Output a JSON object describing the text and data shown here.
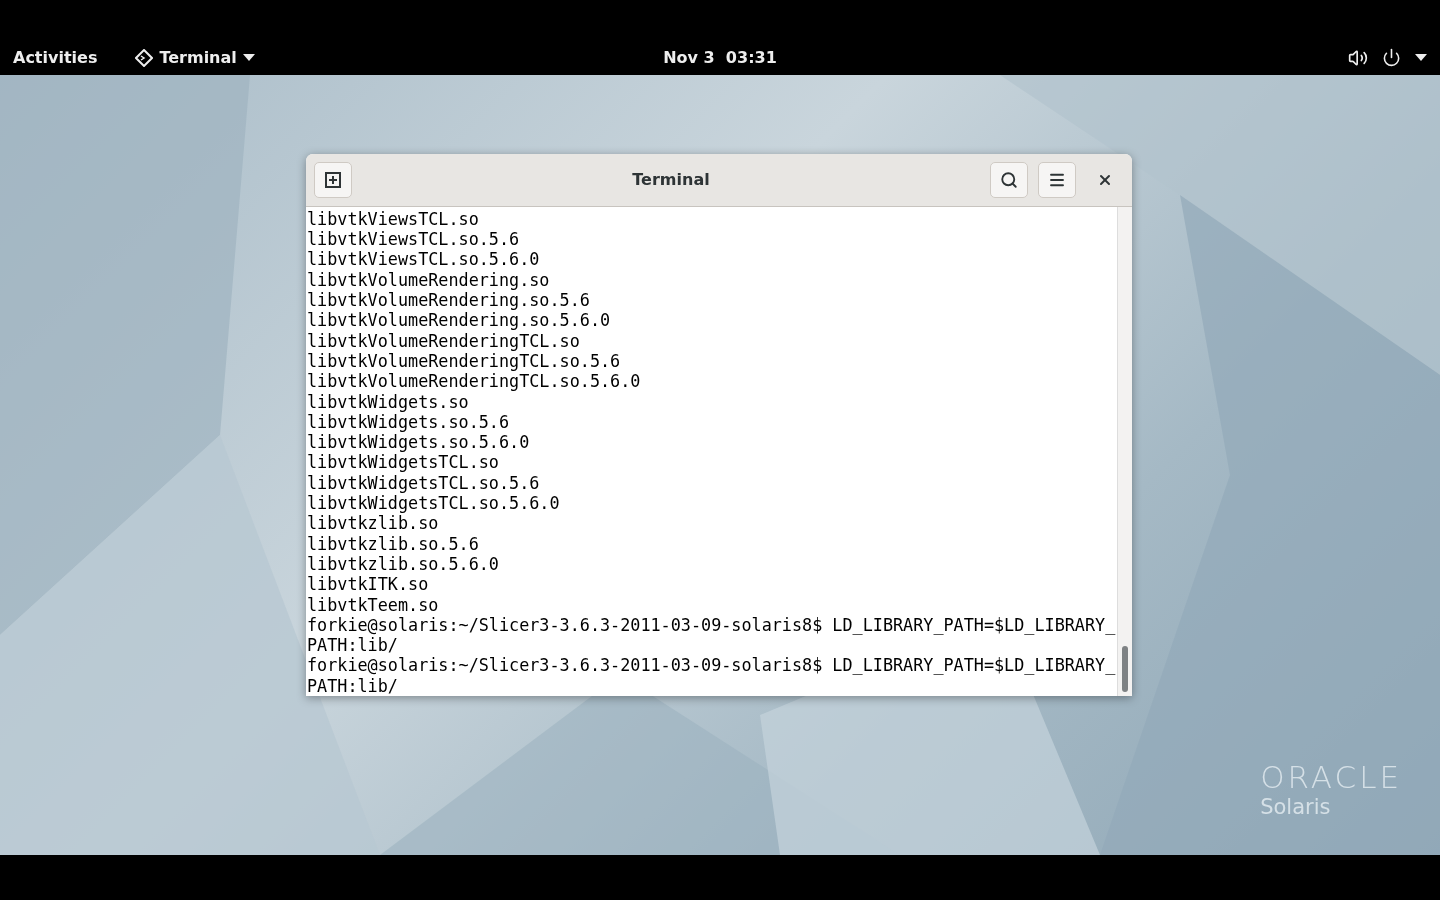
{
  "top_bar": {
    "activities": "Activities",
    "app_menu": "Terminal",
    "clock": "Nov 3  03:31"
  },
  "window": {
    "title": "Terminal",
    "lines": [
      "libvtkViewsTCL.so",
      "libvtkViewsTCL.so.5.6",
      "libvtkViewsTCL.so.5.6.0",
      "libvtkVolumeRendering.so",
      "libvtkVolumeRendering.so.5.6",
      "libvtkVolumeRendering.so.5.6.0",
      "libvtkVolumeRenderingTCL.so",
      "libvtkVolumeRenderingTCL.so.5.6",
      "libvtkVolumeRenderingTCL.so.5.6.0",
      "libvtkWidgets.so",
      "libvtkWidgets.so.5.6",
      "libvtkWidgets.so.5.6.0",
      "libvtkWidgetsTCL.so",
      "libvtkWidgetsTCL.so.5.6",
      "libvtkWidgetsTCL.so.5.6.0",
      "libvtkzlib.so",
      "libvtkzlib.so.5.6",
      "libvtkzlib.so.5.6.0",
      "libvtkITK.so",
      "libvtkTeem.so",
      "forkie@solaris:~/Slicer3-3.6.3-2011-03-09-solaris8$ LD_LIBRARY_PATH=$LD_LIBRARY_PATH:lib/",
      "forkie@solaris:~/Slicer3-3.6.3-2011-03-09-solaris8$ LD_LIBRARY_PATH=$LD_LIBRARY_PATH:lib/"
    ]
  },
  "logo": {
    "brand": "ORACLE",
    "product": "Solaris"
  }
}
